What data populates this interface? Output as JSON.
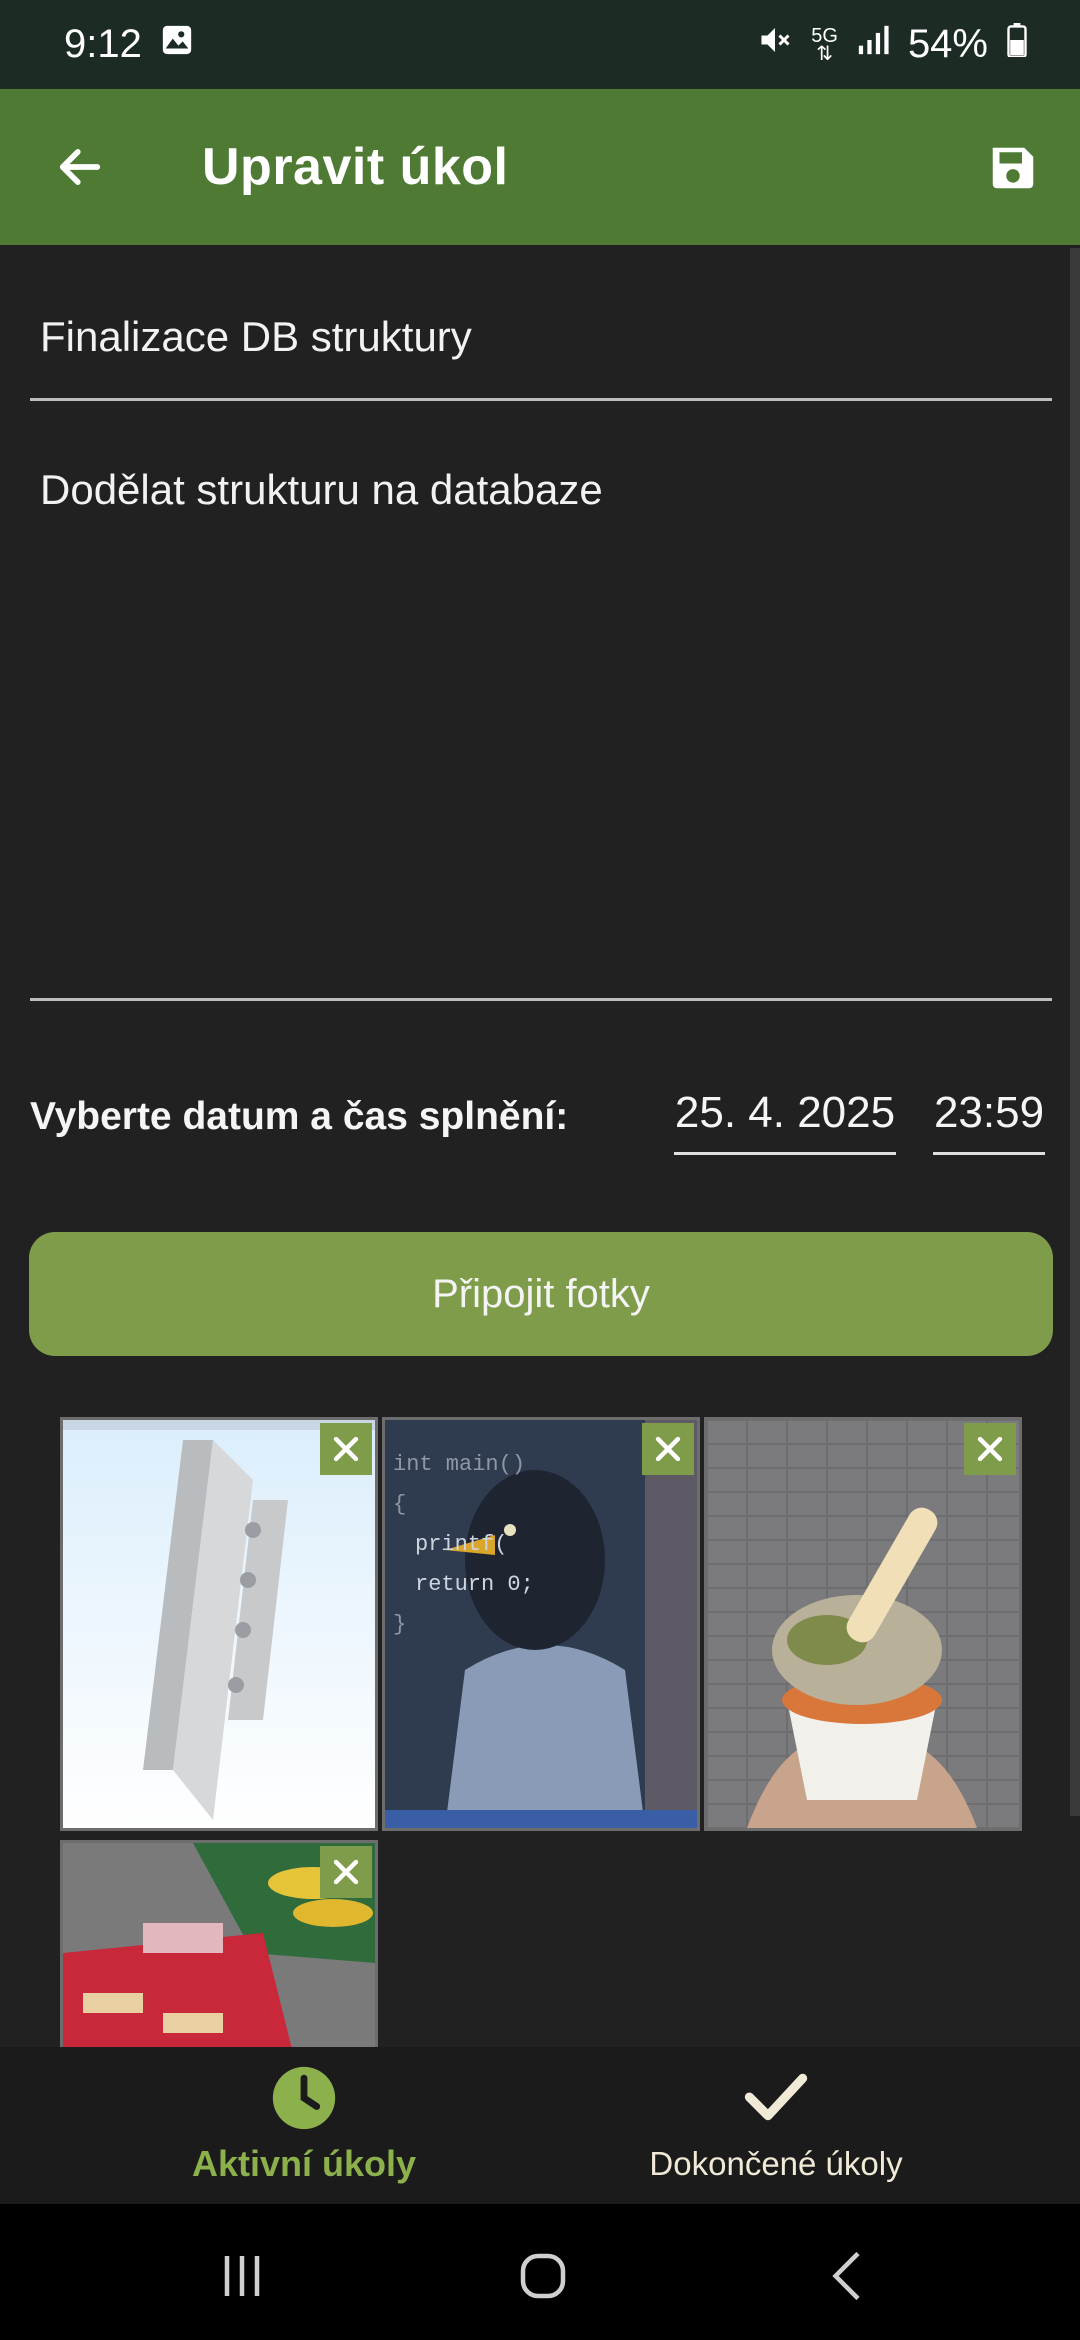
{
  "status_bar": {
    "time": "9:12",
    "battery": "54%",
    "network": "5G",
    "icons": [
      "image-icon",
      "mute-icon",
      "5g-icon",
      "signal-icon",
      "battery-icon"
    ]
  },
  "app_bar": {
    "title": "Upravit úkol",
    "back_icon": "arrow-left-icon",
    "save_icon": "save-icon"
  },
  "form": {
    "title_value": "Finalizace DB struktury",
    "description_value": "Dodělat strukturu na databaze",
    "date_label": "Vyberte datum a čas splnění:",
    "date_value": "25. 4. 2025",
    "time_value": "23:59",
    "attach_button": "Připojit fotky"
  },
  "photos": [
    {
      "name": "bracket-3d-model",
      "remove_icon": "close-icon"
    },
    {
      "name": "bird-programmer",
      "remove_icon": "close-icon"
    },
    {
      "name": "ice-cream",
      "remove_icon": "close-icon"
    },
    {
      "name": "store-shelf",
      "remove_icon": "close-icon"
    }
  ],
  "bottom_nav": {
    "items": [
      {
        "label": "Aktivní úkoly",
        "icon": "clock-icon",
        "active": true
      },
      {
        "label": "Dokončené úkoly",
        "icon": "check-icon",
        "active": false
      }
    ]
  },
  "colors": {
    "app_bar": "#4e7a34",
    "accent": "#7e9c4a",
    "active_nav": "#8cb04c",
    "background": "#212121",
    "status_bar": "#1c2b24"
  }
}
